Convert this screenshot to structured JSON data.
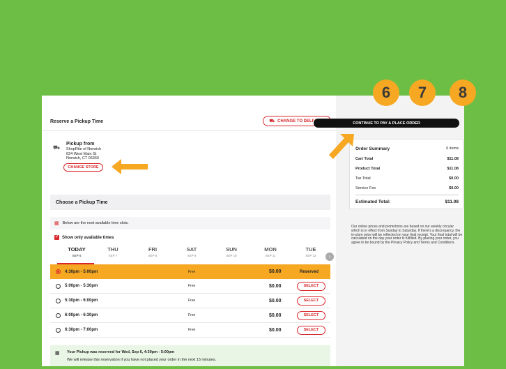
{
  "reserve": {
    "title": "Reserve a Pickup Time",
    "change_delivery": "CHANGE TO DELIVERY"
  },
  "pickup": {
    "heading": "Pickup from",
    "store": "ShopRite of Norwich",
    "street": "634 West Main St",
    "city": "Norwich, CT 06360",
    "change_store": "CHANGE STORE"
  },
  "choose": {
    "title": "Choose a Pickup Time",
    "note": "Below are the next available time slots.",
    "show_only": "Show only available times"
  },
  "days": [
    {
      "name": "TODAY",
      "date": "SEP 6"
    },
    {
      "name": "THU",
      "date": "SEP 7"
    },
    {
      "name": "FRI",
      "date": "SEP 8"
    },
    {
      "name": "SAT",
      "date": "SEP 9"
    },
    {
      "name": "SUN",
      "date": "SEP 10"
    },
    {
      "name": "MON",
      "date": "SEP 11"
    },
    {
      "name": "TUE",
      "date": "SEP 12"
    }
  ],
  "slots": [
    {
      "time": "4:30pm - 5:00pm",
      "fee": "Free",
      "price": "$0.00",
      "action": "Reserved"
    },
    {
      "time": "5:00pm - 5:30pm",
      "fee": "Free",
      "price": "$0.00",
      "action": "SELECT"
    },
    {
      "time": "5:30pm - 6:00pm",
      "fee": "Free",
      "price": "$0.00",
      "action": "SELECT"
    },
    {
      "time": "6:00pm - 6:30pm",
      "fee": "Free",
      "price": "$0.00",
      "action": "SELECT"
    },
    {
      "time": "6:30pm - 7:00pm",
      "fee": "Free",
      "price": "$0.00",
      "action": "SELECT"
    }
  ],
  "reservation_msg": {
    "line1": "Your Pickup was reserved for Wed, Sep 6, 4:30pm - 5:00pm",
    "line2": "We will release this reservation if you have not placed your order in the next 15 minutes."
  },
  "continue_label": "CONTINUE TO PAY & PLACE ORDER",
  "summary": {
    "title": "Order Summary",
    "items": "6 items",
    "cart_total_label": "Cart Total",
    "cart_total": "$11.08",
    "product_total_label": "Product Total",
    "product_total": "$11.08",
    "tax_label": "Tax Total",
    "tax": "$0.00",
    "service_label": "Service Fee",
    "service": "$0.00",
    "estimated_label": "Estimated Total:",
    "estimated": "$11.08"
  },
  "disclaimer": "Our online prices and promotions are based on our weekly circular which is in effect from Sunday to Saturday. If there's a discrepancy, the in-store price will be reflected on your final receipt. Your final total will be calculated on the day your order is fulfilled. By placing your order, you agree to be bound by the Privacy Policy and Terms and Conditions.",
  "steps": [
    "6",
    "7",
    "8"
  ],
  "colors": {
    "background": "#6cbe45",
    "accent": "#d9262c",
    "highlight": "#f7a823"
  },
  "icons": {
    "truck": "truck-icon",
    "calendar": "calendar-icon",
    "checkbox": "checkbox-checked-icon",
    "next": "chevron-right-icon"
  }
}
